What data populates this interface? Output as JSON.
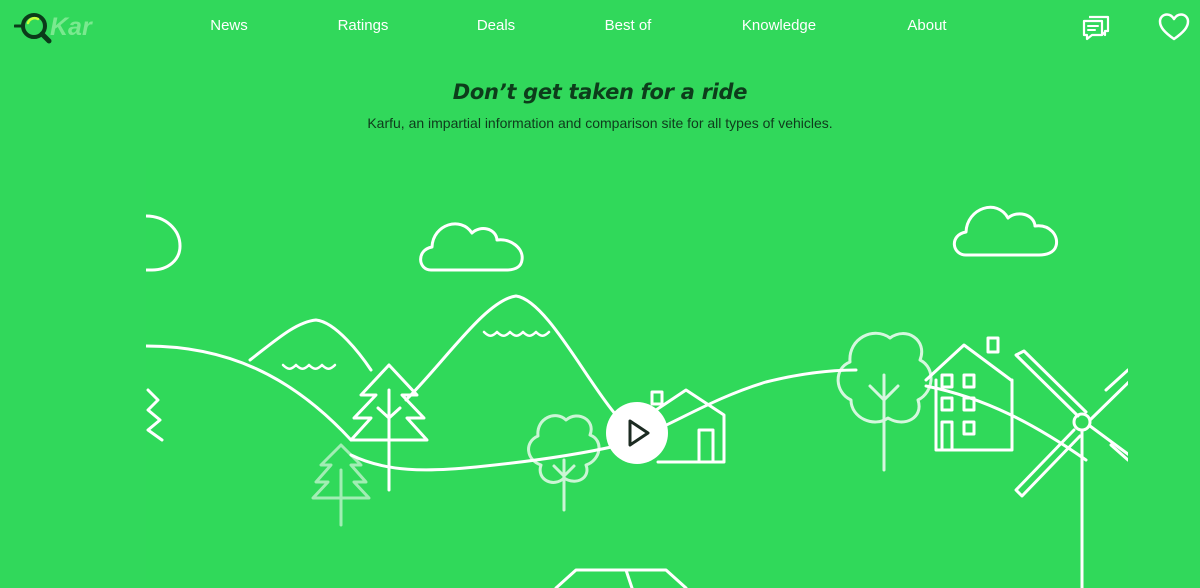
{
  "brand": {
    "logo_text": "Kar"
  },
  "nav": {
    "items": [
      {
        "label": "News"
      },
      {
        "label": "Ratings"
      },
      {
        "label": "Deals"
      },
      {
        "label": "Best of"
      },
      {
        "label": "Knowledge"
      },
      {
        "label": "About"
      }
    ],
    "icons": [
      "chat-icon",
      "heart-icon"
    ]
  },
  "hero": {
    "headline": "Don’t get taken for a ride",
    "subline": "Karfu, an impartial information and comparison site for all types of vehicles."
  },
  "video": {
    "icon": "play-icon"
  },
  "colors": {
    "background": "#31d85b",
    "headline": "#0d3d1b",
    "logo_dark": "#0b3b1a",
    "line_art": "#ffffff"
  }
}
